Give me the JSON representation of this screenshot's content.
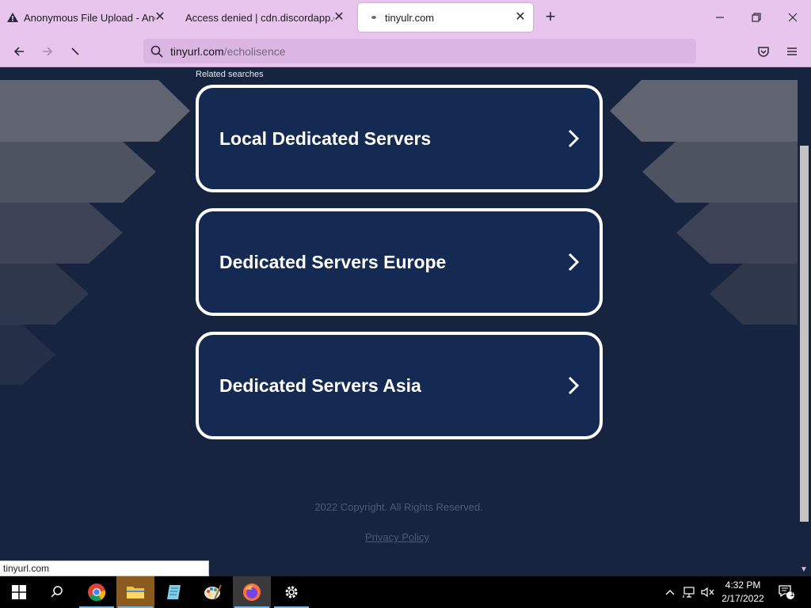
{
  "browser": {
    "tabs": [
      {
        "title": "Anonymous File Upload - Anon",
        "active": false
      },
      {
        "title": "Access denied | cdn.discordapp.com",
        "active": false
      },
      {
        "title": "tinyulr.com",
        "active": true
      }
    ],
    "url_host": "tinyurl.com",
    "url_path": "/echolisence"
  },
  "page": {
    "related_label": "Related searches",
    "results": [
      {
        "label": "Local Dedicated Servers"
      },
      {
        "label": "Dedicated Servers Europe"
      },
      {
        "label": "Dedicated Servers Asia"
      }
    ],
    "copyright": "2022 Copyright. All Rights Reserved.",
    "privacy_label": "Privacy Policy"
  },
  "status_bar": "tinyurl.com",
  "taskbar": {
    "time": "4:32 PM",
    "date": "2/17/2022",
    "notification_count": "1"
  },
  "colors": {
    "chrome_bg": "#e7c5ec",
    "page_bg": "#16243f",
    "card_bg": "#142a52",
    "card_border": "#ffffff"
  }
}
